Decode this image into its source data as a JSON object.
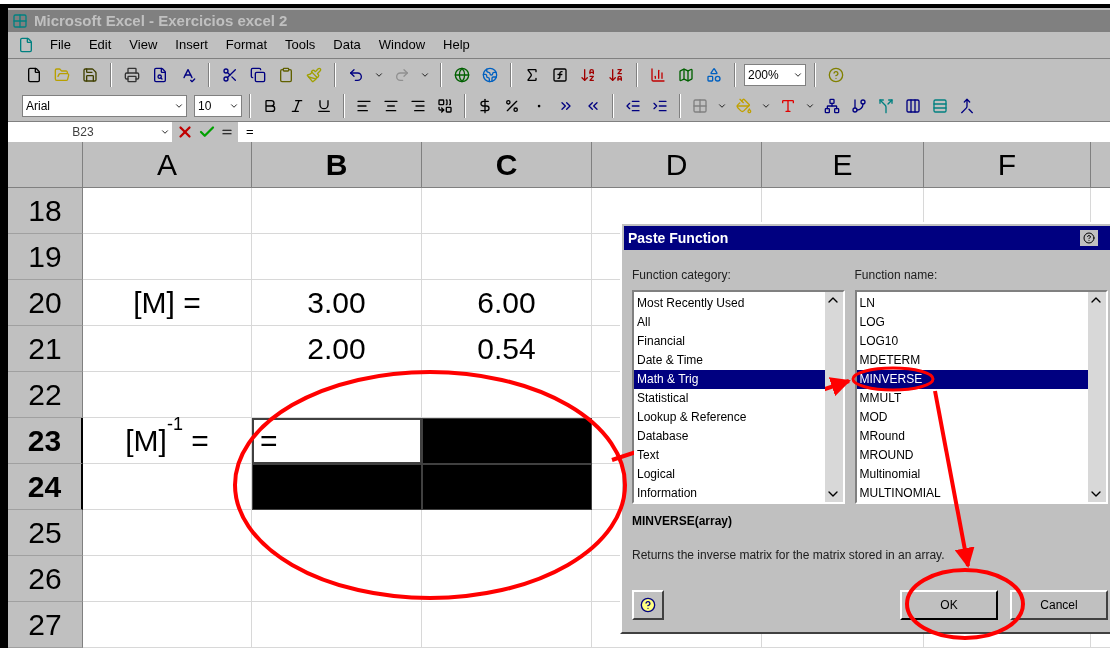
{
  "window": {
    "title": "Microsoft Excel - Exercicios excel 2"
  },
  "menu": [
    {
      "label": "File"
    },
    {
      "label": "Edit"
    },
    {
      "label": "View"
    },
    {
      "label": "Insert"
    },
    {
      "label": "Format"
    },
    {
      "label": "Tools"
    },
    {
      "label": "Data"
    },
    {
      "label": "Window"
    },
    {
      "label": "Help"
    }
  ],
  "standard_toolbar": {
    "zoom": "200%"
  },
  "formatting_toolbar": {
    "font": "Arial",
    "size": "10"
  },
  "formula_bar": {
    "name_box": "B23",
    "formula": "="
  },
  "sheet": {
    "columns": [
      {
        "label": "A",
        "selected": false
      },
      {
        "label": "B",
        "selected": true
      },
      {
        "label": "C",
        "selected": true
      },
      {
        "label": "D",
        "selected": false
      },
      {
        "label": "E",
        "selected": false
      },
      {
        "label": "F",
        "selected": false
      }
    ],
    "rows": [
      {
        "label": "18",
        "selected": false,
        "cells": [
          {
            "selected": false,
            "active": false
          },
          {
            "selected": false,
            "active": false
          },
          {
            "selected": false,
            "active": false
          }
        ]
      },
      {
        "label": "19",
        "selected": false,
        "cells": [
          {
            "selected": false,
            "active": false
          },
          {
            "selected": false,
            "active": false
          },
          {
            "selected": false,
            "active": false
          }
        ]
      },
      {
        "label": "20",
        "selected": false,
        "cells": [
          {
            "text": "[M] =",
            "selected": false,
            "active": false
          },
          {
            "text": "3.00",
            "selected": false,
            "active": false
          },
          {
            "text": "6.00",
            "selected": false,
            "active": false
          }
        ]
      },
      {
        "label": "21",
        "selected": false,
        "cells": [
          {
            "selected": false,
            "active": false
          },
          {
            "text": "2.00",
            "selected": false,
            "active": false
          },
          {
            "text": "0.54",
            "selected": false,
            "active": false
          }
        ]
      },
      {
        "label": "22",
        "selected": false,
        "cells": [
          {
            "selected": false,
            "active": false
          },
          {
            "selected": false,
            "active": false
          },
          {
            "selected": false,
            "active": false
          }
        ]
      },
      {
        "label": "23",
        "selected": true,
        "cells": [
          {
            "text": "[M]$^{-1}$ =",
            "selected": false,
            "active": false
          },
          {
            "text": "=",
            "selected": true,
            "active": true
          },
          {
            "selected": true,
            "active": false
          }
        ]
      },
      {
        "label": "24",
        "selected": true,
        "cells": [
          {
            "selected": false,
            "active": false
          },
          {
            "selected": true,
            "active": false
          },
          {
            "selected": true,
            "active": false
          }
        ]
      },
      {
        "label": "25",
        "selected": false,
        "cells": [
          {
            "selected": false,
            "active": false
          },
          {
            "selected": false,
            "active": false
          },
          {
            "selected": false,
            "active": false
          }
        ]
      },
      {
        "label": "26",
        "selected": false,
        "cells": [
          {
            "selected": false,
            "active": false
          },
          {
            "selected": false,
            "active": false
          },
          {
            "selected": false,
            "active": false
          }
        ]
      },
      {
        "label": "27",
        "selected": false,
        "cells": [
          {
            "selected": false,
            "active": false
          },
          {
            "selected": false,
            "active": false
          },
          {
            "selected": false,
            "active": false
          }
        ]
      }
    ]
  },
  "dialog": {
    "title": "Paste Function",
    "category_label": "Function category:",
    "name_label": "Function name:",
    "categories": [
      {
        "label": "Most Recently Used",
        "selected": false
      },
      {
        "label": "All",
        "selected": false
      },
      {
        "label": "Financial",
        "selected": false
      },
      {
        "label": "Date & Time",
        "selected": false
      },
      {
        "label": "Math & Trig",
        "selected": true
      },
      {
        "label": "Statistical",
        "selected": false
      },
      {
        "label": "Lookup & Reference",
        "selected": false
      },
      {
        "label": "Database",
        "selected": false
      },
      {
        "label": "Text",
        "selected": false
      },
      {
        "label": "Logical",
        "selected": false
      },
      {
        "label": "Information",
        "selected": false
      }
    ],
    "functions": [
      {
        "label": "LN",
        "selected": false
      },
      {
        "label": "LOG",
        "selected": false
      },
      {
        "label": "LOG10",
        "selected": false
      },
      {
        "label": "MDETERM",
        "selected": false
      },
      {
        "label": "MINVERSE",
        "selected": true
      },
      {
        "label": "MMULT",
        "selected": false
      },
      {
        "label": "MOD",
        "selected": false
      },
      {
        "label": "MRound",
        "selected": false
      },
      {
        "label": "MROUND",
        "selected": false
      },
      {
        "label": "Multinomial",
        "selected": false
      },
      {
        "label": "MULTINOMIAL",
        "selected": false
      }
    ],
    "signature": "MINVERSE(array)",
    "description": "Returns the inverse matrix for the matrix stored in an array.",
    "buttons": [
      {
        "label": "OK",
        "kind": "default"
      },
      {
        "label": "Cancel",
        "kind": "normal"
      }
    ]
  }
}
